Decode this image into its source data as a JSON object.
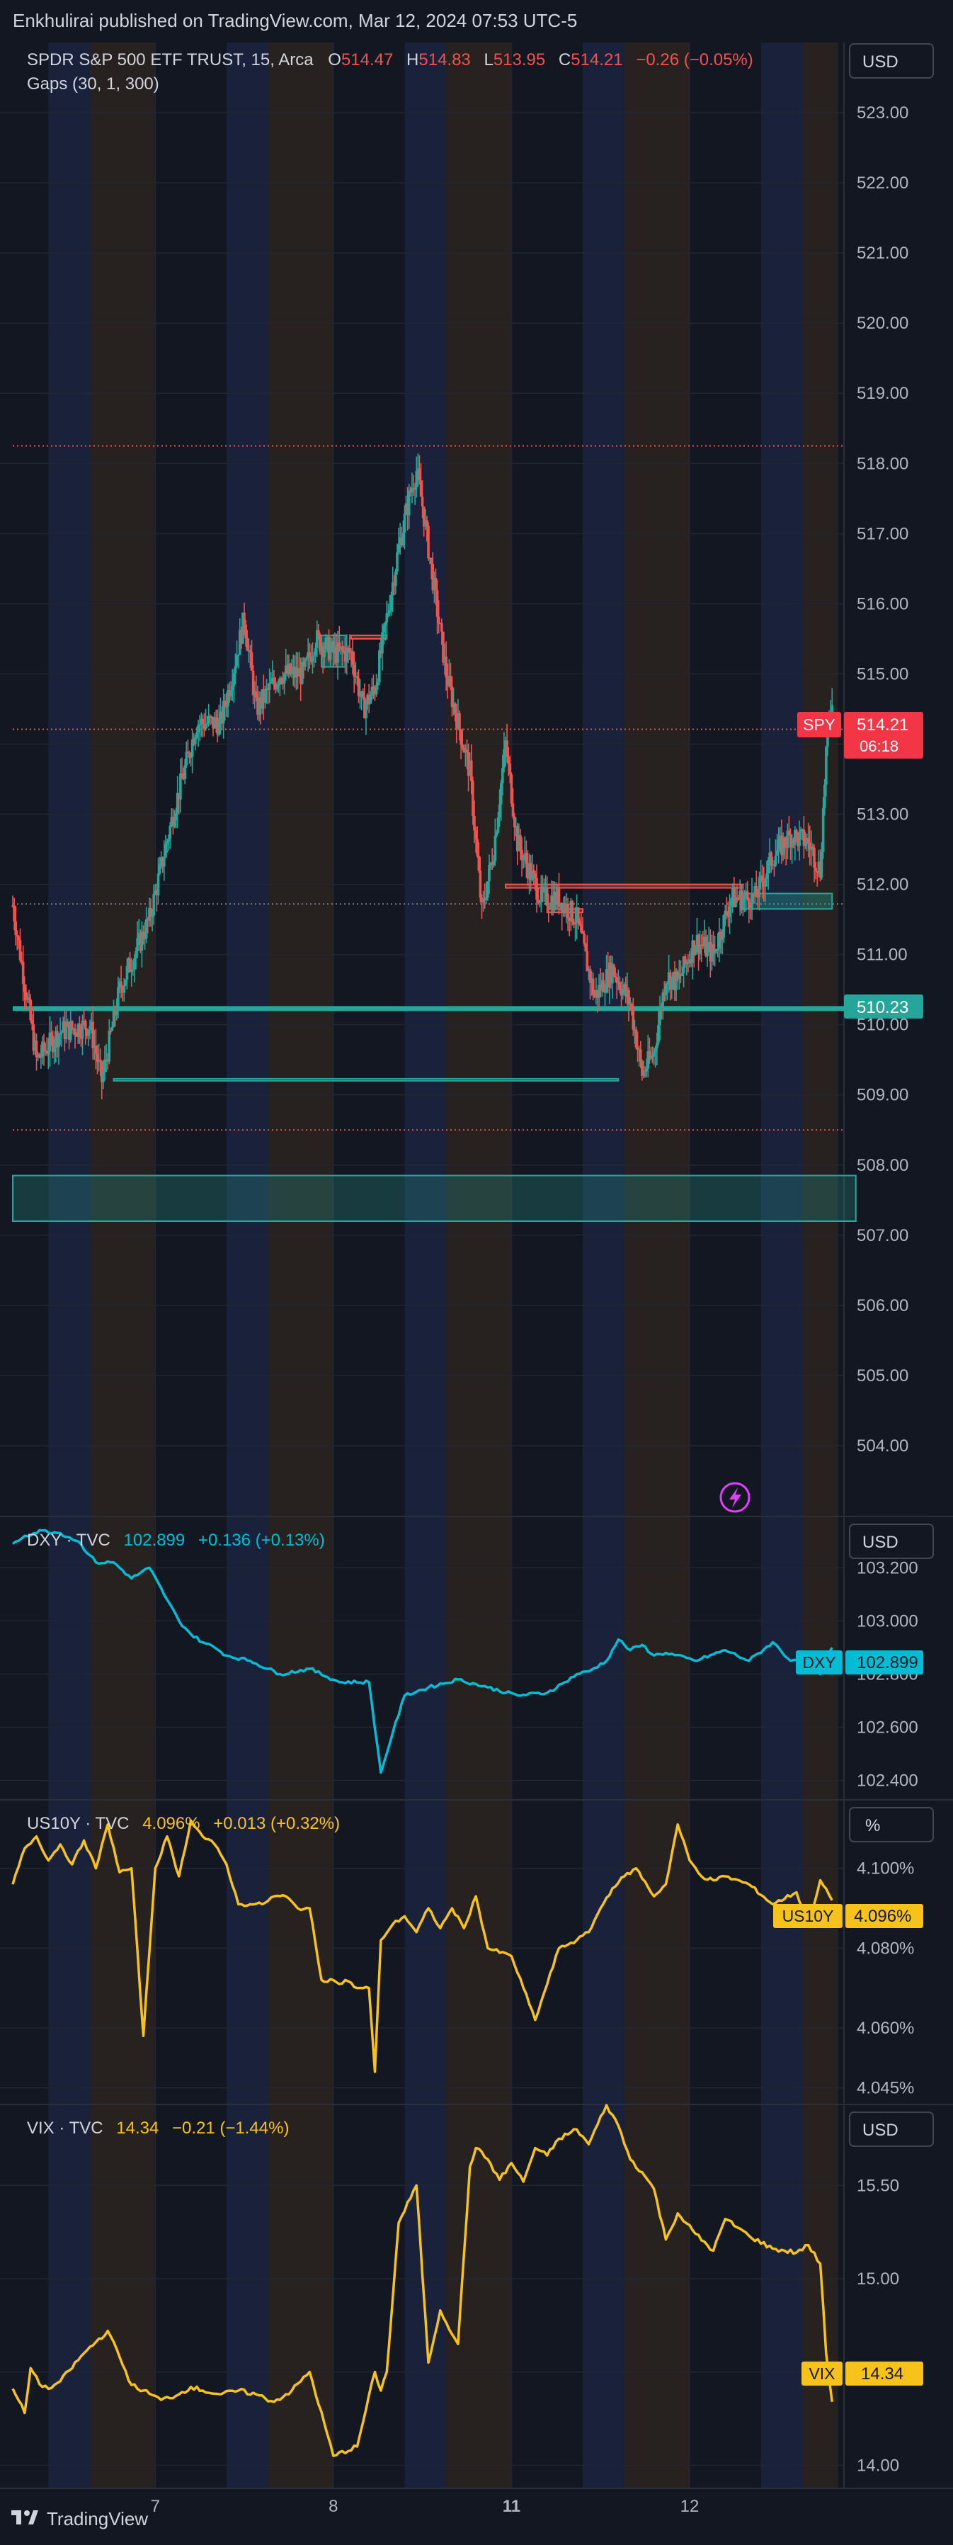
{
  "header": {
    "publisher": "Enkhulirai published on TradingView.com, Mar 12, 2024 07:53 UTC-5"
  },
  "footer": {
    "brand": "TradingView"
  },
  "colors": {
    "background": "#131722",
    "up": "#26a69a",
    "down": "#ef5350",
    "dxy": "#00bcd4",
    "us10y": "#f7c31b",
    "vix": "#f7c31b",
    "session_blue": "#1c2540",
    "session_brown": "#2c2420"
  },
  "main": {
    "symbol": "SPDR S&P 500 ETF TRUST, 15, Arca",
    "o_label": "O",
    "o_value": "514.47",
    "h_label": "H",
    "h_value": "514.83",
    "l_label": "L",
    "l_value": "513.95",
    "c_label": "C",
    "c_value": "514.21",
    "change": "−0.26 (−0.05%)",
    "indicator": "Gaps (30, 1, 300)",
    "currency": "USD",
    "last_tag": "SPY",
    "last_price": "514.21",
    "countdown": "06:18",
    "level_tag": "510.23"
  },
  "dxy": {
    "title": "DXY · TVC",
    "value": "102.899",
    "change": "+0.136 (+0.13%)",
    "currency": "USD",
    "tag": "DXY",
    "tag_value": "102.899"
  },
  "us10y": {
    "title": "US10Y · TVC",
    "value": "4.096%",
    "change": "+0.013 (+0.32%)",
    "currency": "%",
    "tag": "US10Y",
    "tag_value": "4.096%"
  },
  "vix": {
    "title": "VIX · TVC",
    "value": "14.34",
    "change": "−0.21 (−1.44%)",
    "currency": "USD",
    "tag": "VIX",
    "tag_value": "14.34"
  },
  "chart_data": [
    {
      "type": "candlestick",
      "title": "SPDR S&P 500 ETF TRUST, 15, Arca",
      "x_ticks": [
        "7",
        "8",
        "11",
        "12"
      ],
      "y_ticks": [
        "504.00",
        "505.00",
        "506.00",
        "507.00",
        "508.00",
        "509.00",
        "510.00",
        "511.00",
        "512.00",
        "513.00",
        "514.00",
        "515.00",
        "516.00",
        "517.00",
        "518.00",
        "519.00",
        "520.00",
        "521.00",
        "522.00",
        "523.00"
      ],
      "ylim": [
        503.0,
        524.0
      ],
      "close_path": [
        [
          0,
          511.7
        ],
        [
          4,
          509.5
        ],
        [
          8,
          509.9
        ],
        [
          13,
          510.0
        ],
        [
          15,
          509.2
        ],
        [
          18,
          510.5
        ],
        [
          23,
          511.5
        ],
        [
          27,
          513.0
        ],
        [
          31,
          514.3
        ],
        [
          35,
          514.3
        ],
        [
          37,
          515.0
        ],
        [
          39,
          515.8
        ],
        [
          41,
          514.5
        ],
        [
          45,
          515.0
        ],
        [
          49,
          515.0
        ],
        [
          51,
          515.5
        ],
        [
          54,
          515.3
        ],
        [
          57,
          515.3
        ],
        [
          59,
          514.5
        ],
        [
          61,
          514.8
        ],
        [
          64,
          516.3
        ],
        [
          65,
          516.8
        ],
        [
          67,
          517.6
        ],
        [
          68,
          517.9
        ],
        [
          69,
          517.4
        ],
        [
          71,
          516.2
        ],
        [
          73,
          515.0
        ],
        [
          75,
          514.3
        ],
        [
          77,
          513.6
        ],
        [
          79,
          511.6
        ],
        [
          81,
          512.5
        ],
        [
          83,
          514.0
        ],
        [
          85,
          512.6
        ],
        [
          87,
          512.2
        ],
        [
          89,
          511.8
        ],
        [
          92,
          511.8
        ],
        [
          95,
          511.5
        ],
        [
          98,
          510.4
        ],
        [
          101,
          510.8
        ],
        [
          104,
          510.3
        ],
        [
          106,
          509.3
        ],
        [
          108,
          509.6
        ],
        [
          110,
          510.7
        ],
        [
          112,
          510.6
        ],
        [
          115,
          511.2
        ],
        [
          118,
          511.0
        ],
        [
          121,
          511.8
        ],
        [
          125,
          511.8
        ],
        [
          128,
          512.4
        ],
        [
          131,
          512.7
        ],
        [
          134,
          512.6
        ],
        [
          136,
          512.2
        ],
        [
          137,
          513.9
        ],
        [
          138,
          514.7
        ]
      ],
      "levels": [
        {
          "value": 518.25,
          "style": "dotted",
          "color": "#ef5350"
        },
        {
          "value": 514.21,
          "style": "dotted",
          "color": "#ef5350"
        },
        {
          "value": 511.72,
          "style": "dotted",
          "color": "#787b86"
        },
        {
          "value": 508.5,
          "style": "dotted",
          "color": "#ef5350"
        },
        {
          "value": 510.23,
          "style": "solid",
          "color": "#26a69a"
        }
      ],
      "gap_zones": [
        {
          "from": 507.2,
          "to": 507.85,
          "x_start": 0,
          "x_end": 142,
          "color": "#26a69a"
        }
      ],
      "gaps": [
        {
          "x_start": 17,
          "x_end": 102,
          "top": 509.23,
          "bottom": 509.2,
          "color": "#26a69a"
        },
        {
          "x_start": 52,
          "x_end": 56,
          "top": 515.55,
          "bottom": 515.1,
          "color": "#26a69a"
        },
        {
          "x_start": 57,
          "x_end": 63,
          "top": 515.55,
          "bottom": 515.5,
          "color": "#ef5350"
        },
        {
          "x_start": 83,
          "x_end": 123,
          "top": 512.0,
          "bottom": 511.95,
          "color": "#ef5350"
        },
        {
          "x_start": 90,
          "x_end": 96,
          "top": 511.65,
          "bottom": 511.6,
          "color": "#ef5350"
        },
        {
          "x_start": 123,
          "x_end": 138,
          "top": 511.87,
          "bottom": 511.65,
          "color": "#26a69a"
        }
      ]
    },
    {
      "type": "line",
      "title": "DXY · TVC",
      "y_ticks": [
        "102.400",
        "102.600",
        "102.800",
        "103.000",
        "103.200"
      ],
      "ylim": [
        102.33,
        103.39
      ],
      "x": [
        0,
        2,
        5,
        8,
        11,
        14,
        17,
        20,
        23,
        26,
        28,
        30,
        32,
        34,
        36,
        40,
        45,
        50,
        55,
        60,
        62,
        64,
        66,
        70,
        75,
        80,
        85,
        90,
        93,
        95,
        97,
        100,
        102,
        104,
        106,
        108,
        110,
        115,
        120,
        124,
        128,
        131,
        134,
        136,
        138
      ],
      "values": [
        103.29,
        103.32,
        103.34,
        103.33,
        103.3,
        103.22,
        103.22,
        103.16,
        103.2,
        103.08,
        103.0,
        102.95,
        102.92,
        102.9,
        102.87,
        102.85,
        102.8,
        102.82,
        102.77,
        102.77,
        102.43,
        102.58,
        102.72,
        102.75,
        102.78,
        102.75,
        102.72,
        102.73,
        102.77,
        102.8,
        102.81,
        102.85,
        102.93,
        102.89,
        102.91,
        102.87,
        102.88,
        102.85,
        102.89,
        102.85,
        102.92,
        102.85,
        102.88,
        102.8,
        102.9
      ]
    },
    {
      "type": "line",
      "title": "US10Y · TVC",
      "y_ticks": [
        "4.045%",
        "4.060%",
        "4.080%",
        "4.100%"
      ],
      "ylim": [
        4.041,
        4.117
      ],
      "x": [
        0,
        2,
        4,
        6,
        8,
        10,
        12,
        14,
        16,
        18,
        20,
        22,
        24,
        26,
        28,
        30,
        32,
        34,
        36,
        38,
        40,
        42,
        44,
        46,
        48,
        50,
        52,
        54,
        55,
        56,
        58,
        60,
        61,
        62,
        64,
        66,
        68,
        70,
        72,
        74,
        76,
        78,
        80,
        84,
        88,
        92,
        95,
        97,
        99,
        101,
        103,
        105,
        108,
        110,
        112,
        114,
        116,
        118,
        120,
        124,
        128,
        132,
        134,
        136,
        138
      ],
      "values": [
        4.096,
        4.105,
        4.108,
        4.102,
        4.106,
        4.101,
        4.107,
        4.1,
        4.111,
        4.099,
        4.1,
        4.058,
        4.1,
        4.108,
        4.098,
        4.112,
        4.108,
        4.106,
        4.101,
        4.091,
        4.091,
        4.091,
        4.093,
        4.093,
        4.09,
        4.09,
        4.072,
        4.072,
        4.071,
        4.072,
        4.07,
        4.07,
        4.049,
        4.082,
        4.086,
        4.088,
        4.084,
        4.09,
        4.085,
        4.09,
        4.085,
        4.093,
        4.08,
        4.078,
        4.062,
        4.08,
        4.082,
        4.084,
        4.09,
        4.095,
        4.098,
        4.1,
        4.093,
        4.096,
        4.111,
        4.102,
        4.098,
        4.097,
        4.098,
        4.096,
        4.091,
        4.094,
        4.086,
        4.097,
        4.092
      ]
    },
    {
      "type": "line",
      "title": "VIX · TVC",
      "y_ticks": [
        "14.00",
        "14.50",
        "15.00",
        "15.50"
      ],
      "ylim": [
        13.88,
        15.93
      ],
      "x": [
        0,
        2,
        3,
        5,
        6,
        8,
        12,
        16,
        18,
        20,
        22,
        25,
        28,
        30,
        32,
        35,
        38,
        41,
        44,
        47,
        50,
        54,
        58,
        61,
        62,
        63,
        65,
        68,
        70,
        72,
        75,
        77,
        78,
        80,
        82,
        84,
        86,
        88,
        90,
        92,
        95,
        97,
        100,
        102,
        104,
        106,
        108,
        110,
        112,
        115,
        118,
        120,
        124,
        128,
        132,
        134,
        136,
        137,
        138
      ],
      "values": [
        14.41,
        14.28,
        14.52,
        14.42,
        14.41,
        14.45,
        14.6,
        14.72,
        14.58,
        14.43,
        14.4,
        14.35,
        14.38,
        14.42,
        14.4,
        14.38,
        14.4,
        14.38,
        14.34,
        14.4,
        14.5,
        14.05,
        14.1,
        14.5,
        14.4,
        14.5,
        15.3,
        15.5,
        14.55,
        14.83,
        14.65,
        15.6,
        15.7,
        15.64,
        15.53,
        15.62,
        15.52,
        15.7,
        15.66,
        15.75,
        15.8,
        15.72,
        15.93,
        15.82,
        15.64,
        15.57,
        15.48,
        15.21,
        15.35,
        15.24,
        15.15,
        15.32,
        15.23,
        15.16,
        15.14,
        15.18,
        15.08,
        14.6,
        14.34
      ]
    }
  ]
}
